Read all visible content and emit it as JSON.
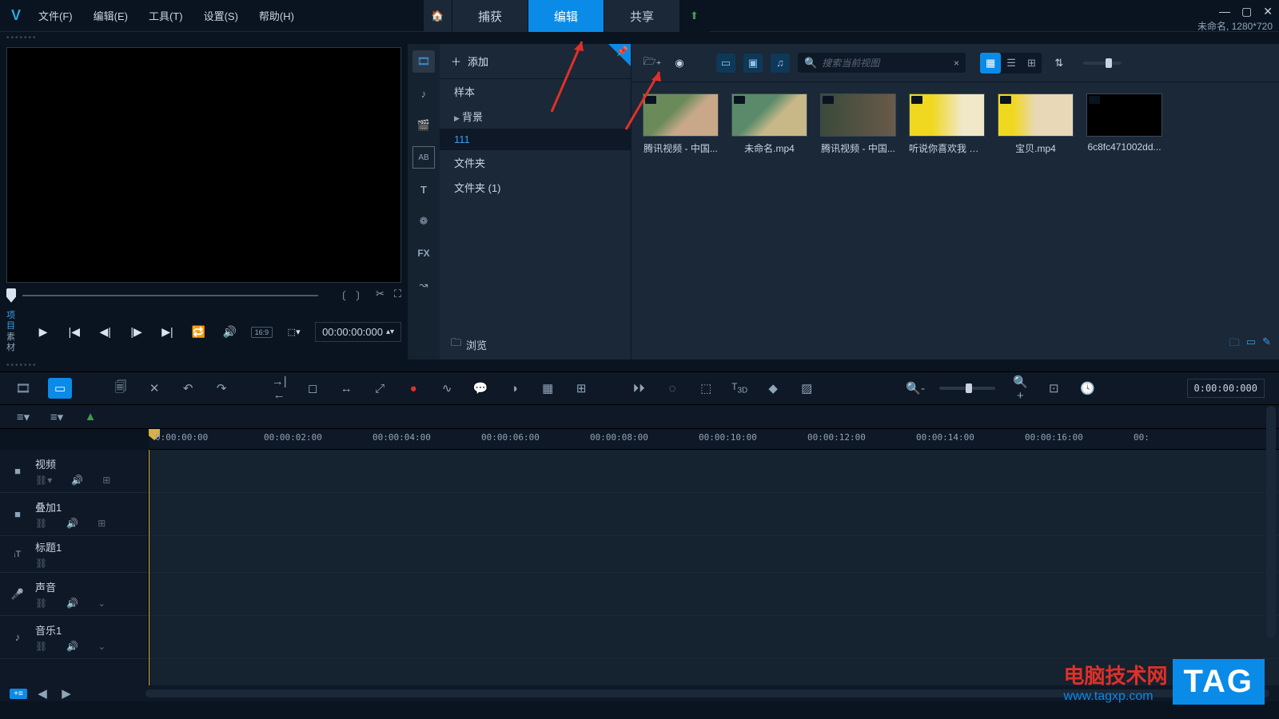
{
  "menubar": {
    "file": "文件(F)",
    "edit": "编辑(E)",
    "tools": "工具(T)",
    "settings": "设置(S)",
    "help": "帮助(H)"
  },
  "tabs": {
    "capture": "捕获",
    "edit": "编辑",
    "share": "共享"
  },
  "project": {
    "title": "未命名, 1280*720"
  },
  "library": {
    "add": "添加",
    "tree": {
      "sample": "样本",
      "background": "背景",
      "folder111": "111",
      "folder": "文件夹",
      "folder1": "文件夹 (1)"
    },
    "browse": "浏览",
    "search_placeholder": "搜索当前视图",
    "items": [
      {
        "label": "腾讯视频 - 中国..."
      },
      {
        "label": "未命名.mp4"
      },
      {
        "label": "腾讯视频 - 中国..."
      },
      {
        "label": "听说你喜欢我 第..."
      },
      {
        "label": "宝贝.mp4"
      },
      {
        "label": "6c8fc471002dd..."
      }
    ]
  },
  "preview": {
    "mode1": "项目",
    "mode2": "素材",
    "timecode": "00:00:00:000",
    "ratio": "16:9"
  },
  "timeline": {
    "timecode": "0:00:00:000",
    "ruler": [
      "0:00:00:00",
      "00:00:02:00",
      "00:00:04:00",
      "00:00:06:00",
      "00:00:08:00",
      "00:00:10:00",
      "00:00:12:00",
      "00:00:14:00",
      "00:00:16:00",
      "00:"
    ],
    "tracks": {
      "video": "视频",
      "overlay": "叠加1",
      "title": "标题1",
      "voice": "声音",
      "music": "音乐1"
    }
  },
  "watermark": {
    "text": "电脑技术网",
    "url": "www.tagxp.com",
    "tag": "TAG"
  }
}
